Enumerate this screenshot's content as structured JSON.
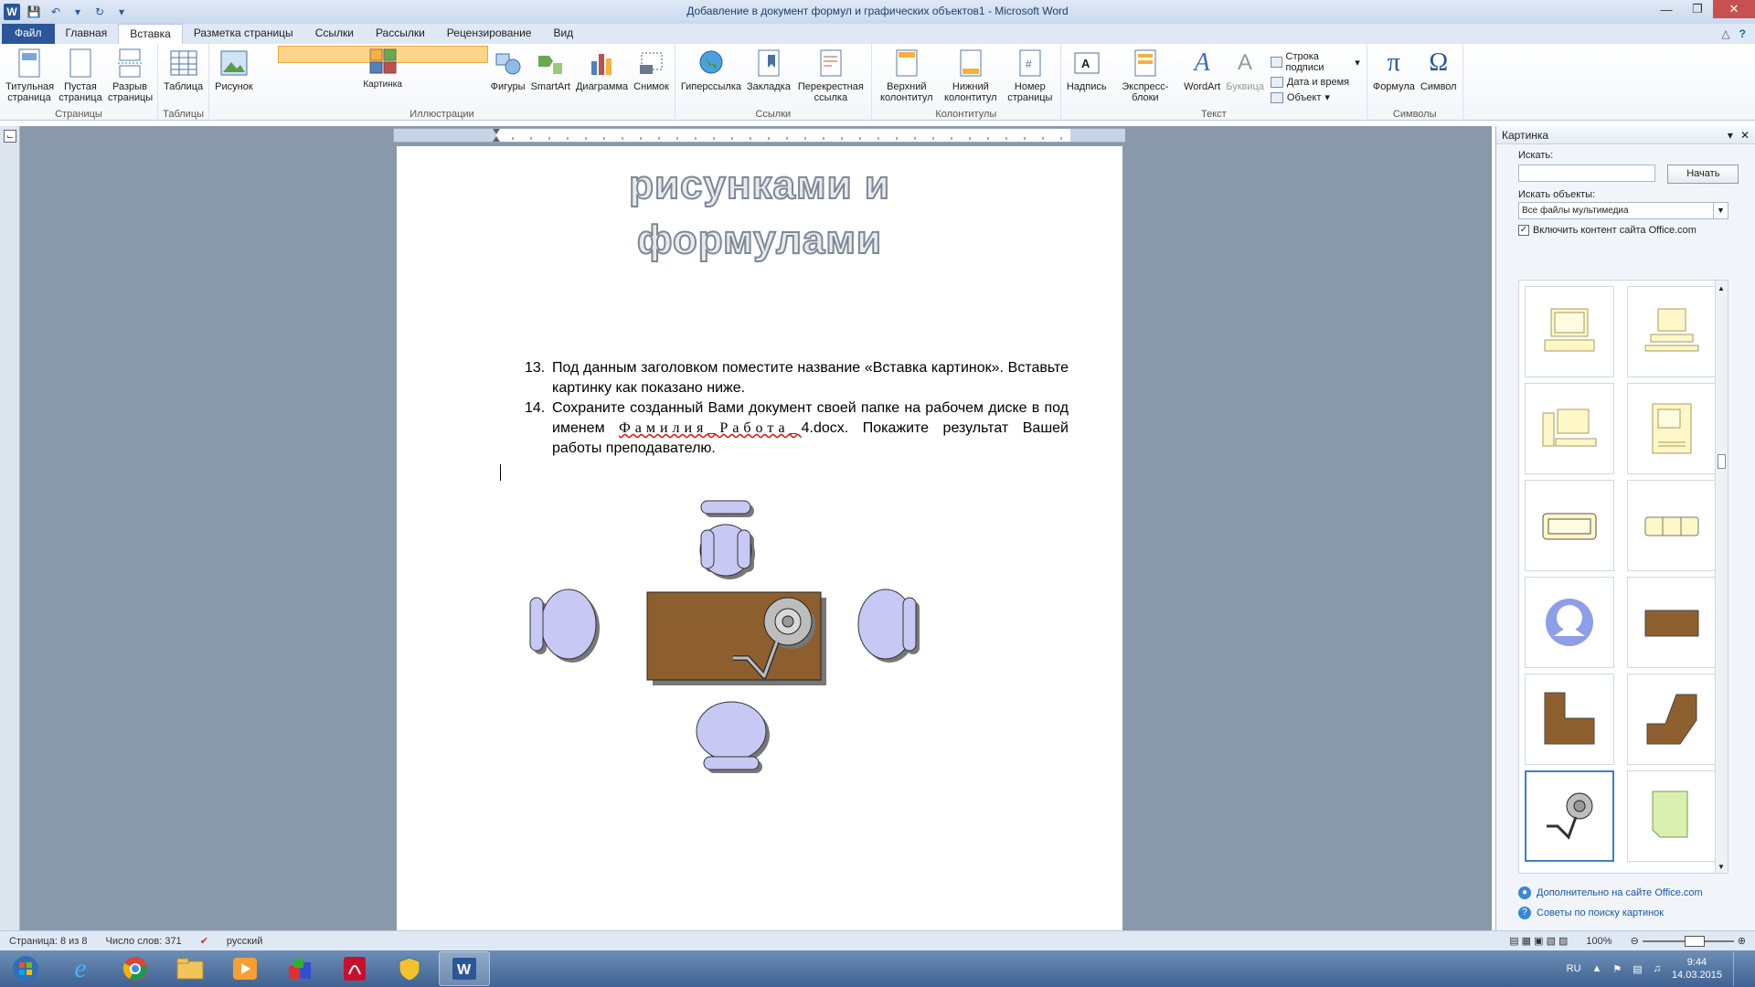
{
  "window": {
    "title": "Добавление в документ формул и графических объектов1 - Microsoft Word"
  },
  "tabs": [
    "Файл",
    "Главная",
    "Вставка",
    "Разметка страницы",
    "Ссылки",
    "Рассылки",
    "Рецензирование",
    "Вид"
  ],
  "active_tab": "Вставка",
  "ribbon": {
    "pages": {
      "label": "Страницы",
      "title": "Титульная страница",
      "blank": "Пустая страница",
      "break": "Разрыв страницы"
    },
    "tables": {
      "label": "Таблицы",
      "table": "Таблица"
    },
    "illustrations": {
      "label": "Иллюстрации",
      "picture": "Рисунок",
      "clipart": "Картинка",
      "shapes": "Фигуры",
      "smartart": "SmartArt",
      "chart": "Диаграмма",
      "screenshot": "Снимок"
    },
    "links": {
      "label": "Ссылки",
      "hyperlink": "Гиперссылка",
      "bookmark": "Закладка",
      "crossref": "Перекрестная ссылка"
    },
    "headers": {
      "label": "Колонтитулы",
      "header": "Верхний колонтитул",
      "footer": "Нижний колонтитул",
      "pagenum": "Номер страницы"
    },
    "text": {
      "label": "Текст",
      "textbox": "Надпись",
      "quickparts": "Экспресс-блоки",
      "wordart": "WordArt",
      "dropcap": "Буквица",
      "sigline": "Строка подписи",
      "datetime": "Дата и время",
      "object": "Объект"
    },
    "symbols": {
      "label": "Символы",
      "equation": "Формула",
      "symbol": "Символ"
    }
  },
  "document": {
    "heading_line1": "рисунками и",
    "heading_line2": "формулами",
    "item13_num": "13.",
    "item13_text": "Под данным заголовком поместите название «Вставка картинок». Вставьте картинку как показано ниже.",
    "item14_num": "14.",
    "item14_pre": "Сохраните созданный Вами документ своей папке на рабочем диске в под именем",
    "item14_fname": "Фамилия_Работа_",
    "item14_post": "4.docx. Покажите результат Вашей работы преподавателю."
  },
  "clipart_pane": {
    "title": "Картинка",
    "search_label": "Искать:",
    "search_value": "",
    "go_button": "Начать",
    "results_label": "Искать объекты:",
    "results_value": "Все файлы мультимедиа",
    "include_office": "Включить контент сайта Office.com",
    "more_link": "Дополнительно на сайте Office.com",
    "tips_link": "Советы по поиску картинок"
  },
  "status": {
    "page": "Страница: 8 из 8",
    "words": "Число слов: 371",
    "lang": "русский",
    "zoom": "100%"
  },
  "taskbar": {
    "lang": "RU",
    "time": "9:44",
    "date": "14.03.2015"
  }
}
